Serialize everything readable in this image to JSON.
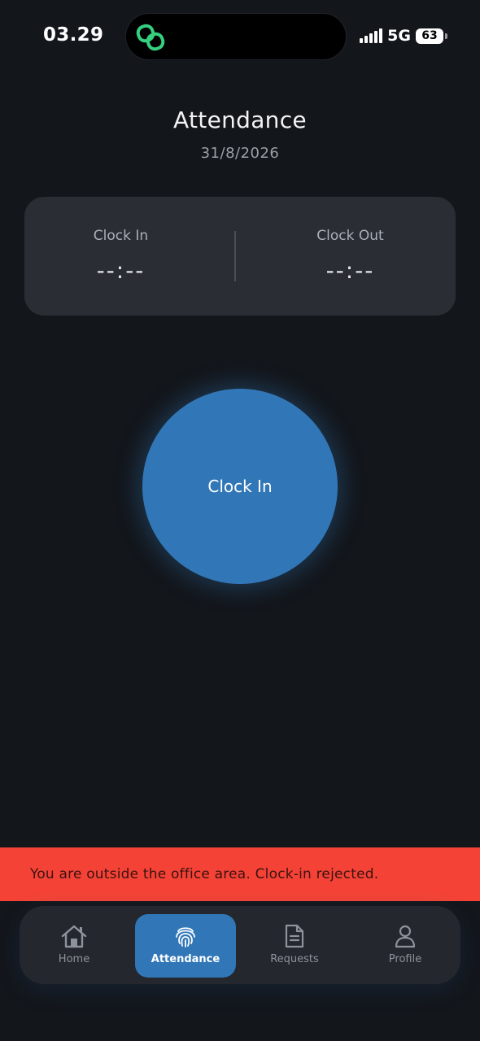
{
  "status_bar": {
    "time": "03.29",
    "network": "5G",
    "battery": "63"
  },
  "header": {
    "title": "Attendance",
    "date": "31/8/2026"
  },
  "time_card": {
    "clock_in_label": "Clock In",
    "clock_in_value": "--:--",
    "clock_out_label": "Clock Out",
    "clock_out_value": "--:--"
  },
  "main_button": {
    "label": "Clock In"
  },
  "toast": {
    "message": "You are outside the office area. Clock-in rejected."
  },
  "nav": {
    "items": [
      {
        "label": "Home",
        "icon": "home-icon",
        "active": false
      },
      {
        "label": "Attendance",
        "icon": "fingerprint-icon",
        "active": true
      },
      {
        "label": "Requests",
        "icon": "document-icon",
        "active": false
      },
      {
        "label": "Profile",
        "icon": "person-icon",
        "active": false
      }
    ]
  },
  "colors": {
    "background": "#13161b",
    "card": "#2a2d33",
    "accent": "#3177b8",
    "error": "#f44336",
    "island_icon": "#35d07f"
  }
}
